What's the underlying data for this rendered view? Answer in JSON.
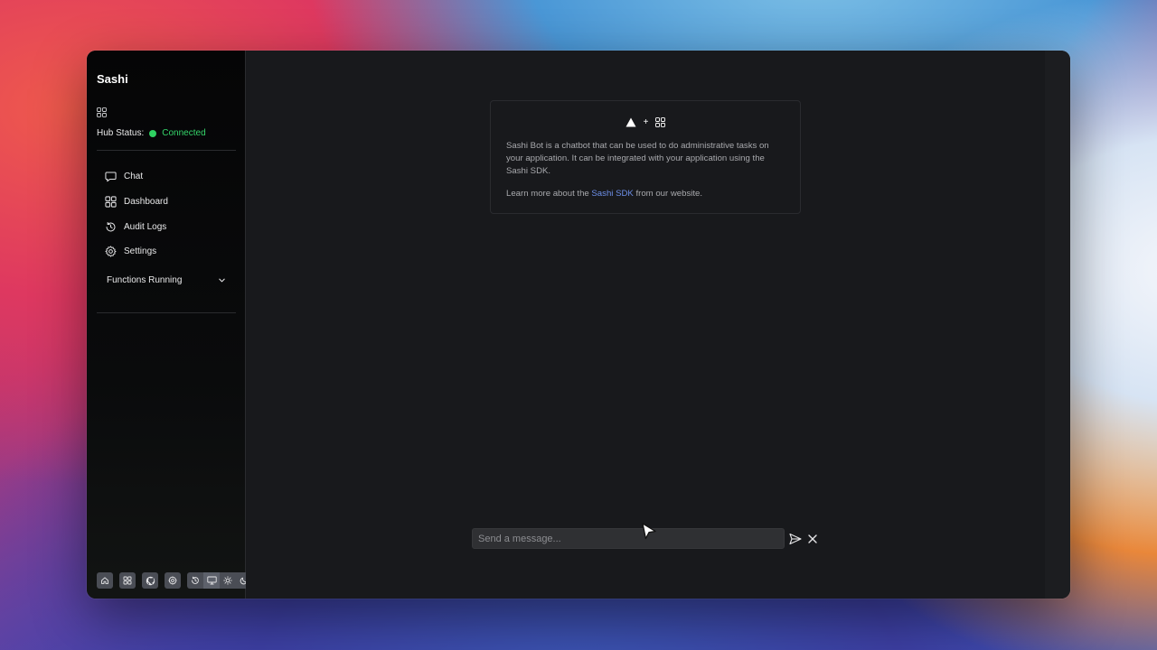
{
  "sidebar": {
    "brand": "Sashi",
    "hub_status_label": "Hub Status:",
    "hub_status_value": "Connected",
    "status_color": "#34d46a",
    "nav": [
      {
        "label": "Chat",
        "icon": "chat-bubble-icon"
      },
      {
        "label": "Dashboard",
        "icon": "grid-icon"
      },
      {
        "label": "Audit Logs",
        "icon": "history-icon"
      },
      {
        "label": "Settings",
        "icon": "gear-icon"
      }
    ],
    "functions_label": "Functions Running",
    "toolbar_icons": [
      "home-icon",
      "grid-icon",
      "github-icon",
      "gear-icon",
      "history-icon",
      "monitor-icon",
      "sun-icon",
      "moon-icon"
    ]
  },
  "info_card": {
    "plus": "+",
    "description": "Sashi Bot is a chatbot that can be used to do administrative tasks on your application. It can be integrated with your application using the Sashi SDK.",
    "learn_prefix": "Learn more about the ",
    "learn_link": "Sashi SDK",
    "learn_suffix": " from our website.",
    "link_color": "#6d8fe8"
  },
  "composer": {
    "placeholder": "Send a message...",
    "value": ""
  }
}
